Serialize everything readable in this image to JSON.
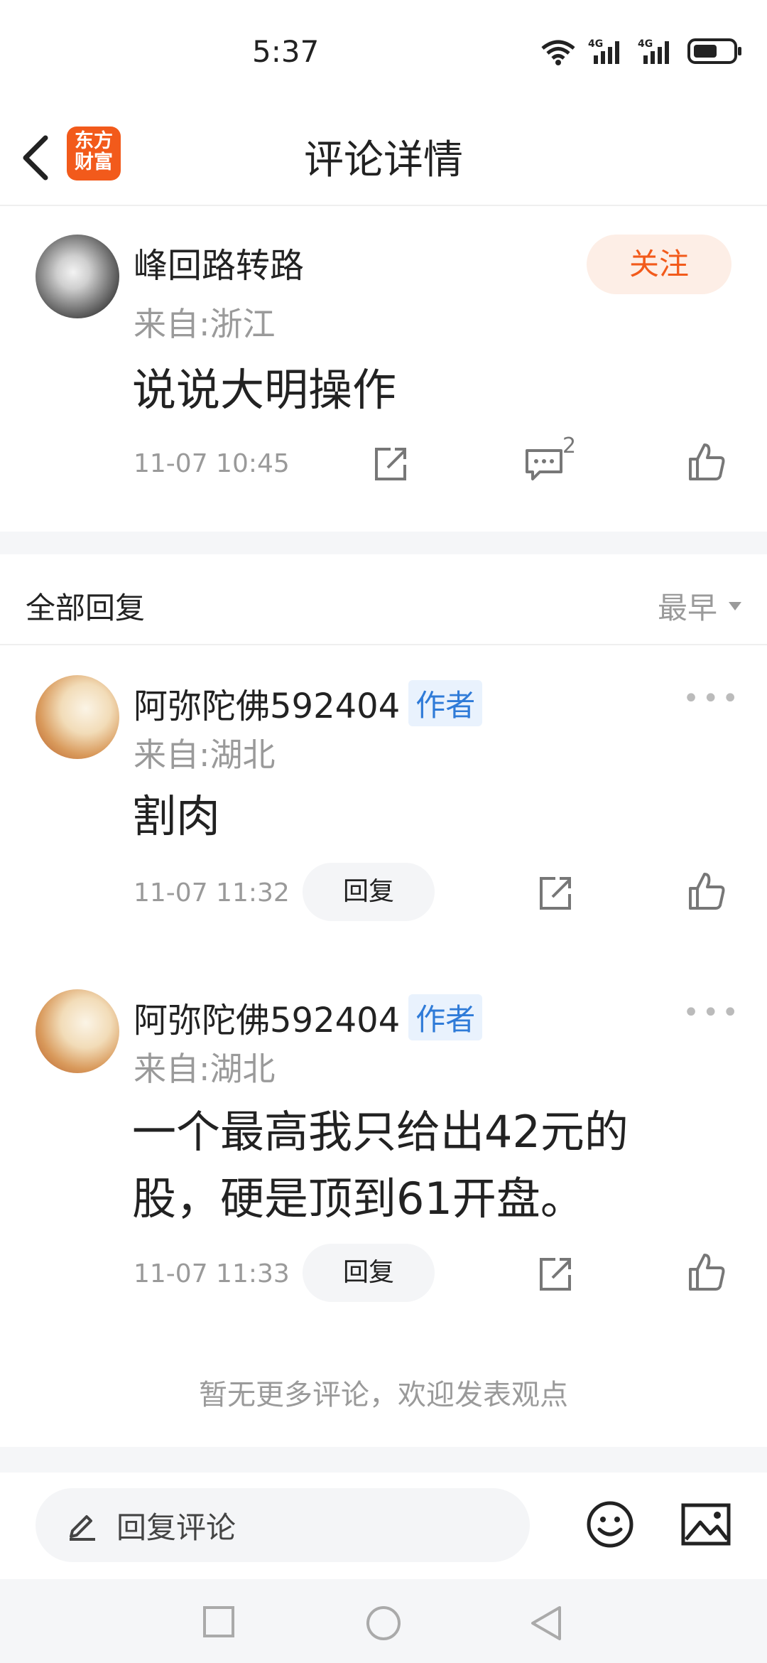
{
  "status_bar": {
    "time": "5:37",
    "wifi_label": "6",
    "signal1_label": "4G",
    "signal2_label": "4G"
  },
  "header": {
    "title": "评论详情",
    "logo_line1": "东方",
    "logo_line2": "财富"
  },
  "main_comment": {
    "username": "峰回路转路",
    "location": "来自:浙江",
    "content": "说说大明操作",
    "timestamp": "11-07 10:45",
    "reply_count": "2",
    "follow_label": "关注"
  },
  "replies_section": {
    "title": "全部回复",
    "sort_label": "最早"
  },
  "replies": [
    {
      "username": "阿弥陀佛592404",
      "badge": "作者",
      "location": "来自:湖北",
      "content_line1": "割肉",
      "content_line2": "",
      "timestamp": "11-07 11:32",
      "reply_label": "回复"
    },
    {
      "username": "阿弥陀佛592404",
      "badge": "作者",
      "location": "来自:湖北",
      "content_line1": "一个最高我只给出42元的",
      "content_line2": "股，硬是顶到61开盘。",
      "timestamp": "11-07 11:33",
      "reply_label": "回复"
    }
  ],
  "footer_note": "暂无更多评论，欢迎发表观点",
  "bottom_bar": {
    "reply_placeholder": "回复评论"
  },
  "icons": [
    "back-icon",
    "share-icon",
    "comment-icon",
    "like-icon",
    "more-icon",
    "dropdown-icon",
    "pencil-icon",
    "emoji-icon",
    "image-icon",
    "nav-recent-icon",
    "nav-home-icon",
    "nav-back-icon"
  ],
  "colors": {
    "accent": "#f25a1b",
    "follow_bg": "#fdeee6",
    "badge_text": "#2f7bd8",
    "badge_bg": "#e9f2fd",
    "muted": "#9a9a9a"
  }
}
